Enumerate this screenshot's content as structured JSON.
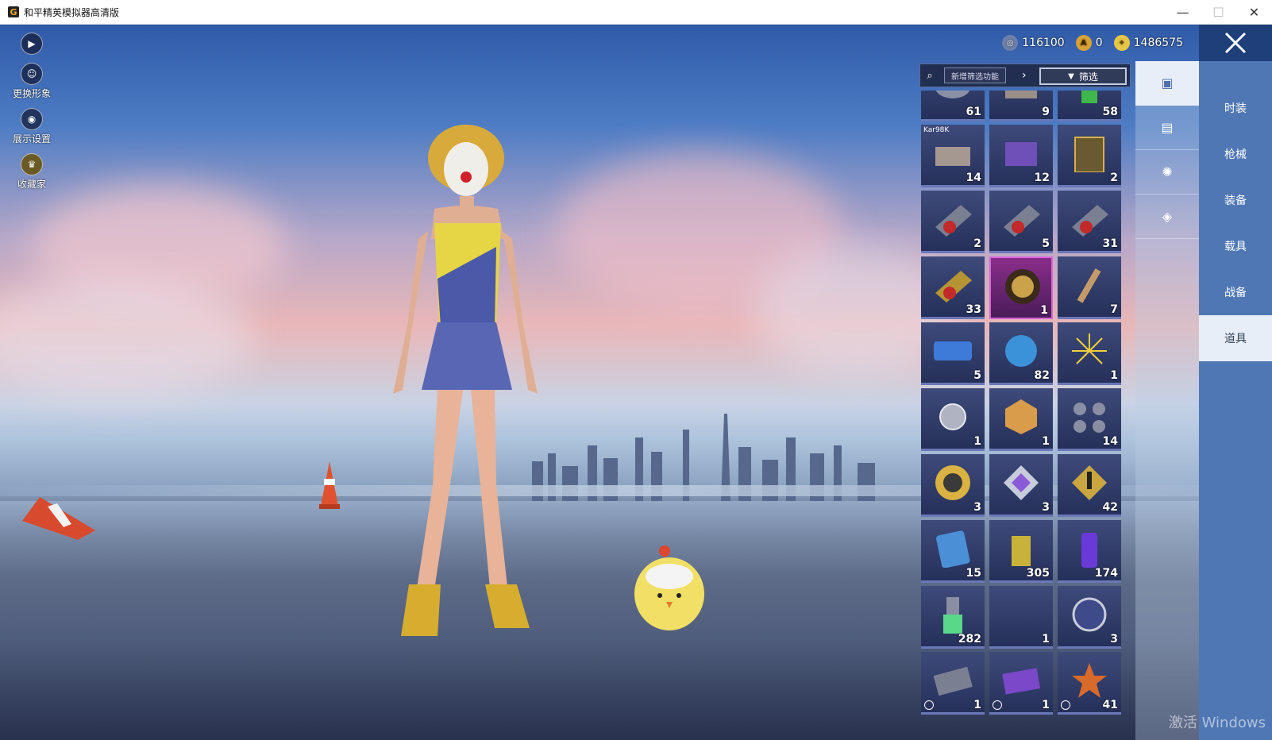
{
  "window": {
    "title": "和平精英模拟器高清版",
    "app_icon_letter": "G",
    "min": "—",
    "max": "☐",
    "close": "✕"
  },
  "left_tools": [
    {
      "icon": "play-arrow",
      "label": ""
    },
    {
      "icon": "avatar",
      "label": "更换形象"
    },
    {
      "icon": "eye",
      "label": "展示设置"
    },
    {
      "icon": "collector",
      "label": "收藏家"
    }
  ],
  "currency": [
    {
      "icon": "globe-coin",
      "value": "116100",
      "color": "#6d7fa8"
    },
    {
      "icon": "ag-coin",
      "value": "0",
      "color": "#d9a035"
    },
    {
      "icon": "gold-coin",
      "value": "1486575",
      "color": "#e8c645"
    }
  ],
  "search": {
    "new_filter": "新增筛选功能",
    "filter": "筛选"
  },
  "grid": [
    {
      "count": "61",
      "tag": "",
      "clock": false,
      "pink": false
    },
    {
      "count": "9",
      "tag": "",
      "clock": false,
      "pink": false
    },
    {
      "count": "58",
      "tag": "",
      "clock": false,
      "pink": false
    },
    {
      "count": "14",
      "tag": "Kar98K",
      "clock": false,
      "pink": false
    },
    {
      "count": "12",
      "tag": "",
      "clock": false,
      "pink": false
    },
    {
      "count": "2",
      "tag": "",
      "clock": false,
      "pink": false
    },
    {
      "count": "2",
      "tag": "",
      "clock": false,
      "pink": false
    },
    {
      "count": "5",
      "tag": "",
      "clock": false,
      "pink": false
    },
    {
      "count": "31",
      "tag": "",
      "clock": false,
      "pink": false
    },
    {
      "count": "33",
      "tag": "",
      "clock": false,
      "pink": false
    },
    {
      "count": "1",
      "tag": "",
      "clock": false,
      "pink": true
    },
    {
      "count": "7",
      "tag": "",
      "clock": false,
      "pink": false
    },
    {
      "count": "5",
      "tag": "",
      "clock": false,
      "pink": false
    },
    {
      "count": "82",
      "tag": "",
      "clock": false,
      "pink": false
    },
    {
      "count": "1",
      "tag": "",
      "clock": false,
      "pink": false
    },
    {
      "count": "1",
      "tag": "",
      "clock": false,
      "pink": false
    },
    {
      "count": "1",
      "tag": "",
      "clock": false,
      "pink": false
    },
    {
      "count": "14",
      "tag": "",
      "clock": false,
      "pink": false
    },
    {
      "count": "3",
      "tag": "",
      "clock": false,
      "pink": false
    },
    {
      "count": "3",
      "tag": "",
      "clock": false,
      "pink": false
    },
    {
      "count": "42",
      "tag": "",
      "clock": false,
      "pink": false
    },
    {
      "count": "15",
      "tag": "",
      "clock": false,
      "pink": false
    },
    {
      "count": "305",
      "tag": "",
      "clock": false,
      "pink": false
    },
    {
      "count": "174",
      "tag": "",
      "clock": false,
      "pink": false
    },
    {
      "count": "282",
      "tag": "",
      "clock": false,
      "pink": false
    },
    {
      "count": "1",
      "tag": "",
      "clock": false,
      "pink": false
    },
    {
      "count": "3",
      "tag": "",
      "clock": false,
      "pink": false
    },
    {
      "count": "1",
      "tag": "",
      "clock": true,
      "pink": false
    },
    {
      "count": "1",
      "tag": "",
      "clock": true,
      "pink": false
    },
    {
      "count": "41",
      "tag": "",
      "clock": true,
      "pink": false
    }
  ],
  "categories": [
    "card",
    "chest",
    "firework",
    "ticket"
  ],
  "tabs": [
    "时装",
    "枪械",
    "装备",
    "载具",
    "战备",
    "道具"
  ],
  "selected_tab": "道具",
  "watermark": "激活 Windows"
}
